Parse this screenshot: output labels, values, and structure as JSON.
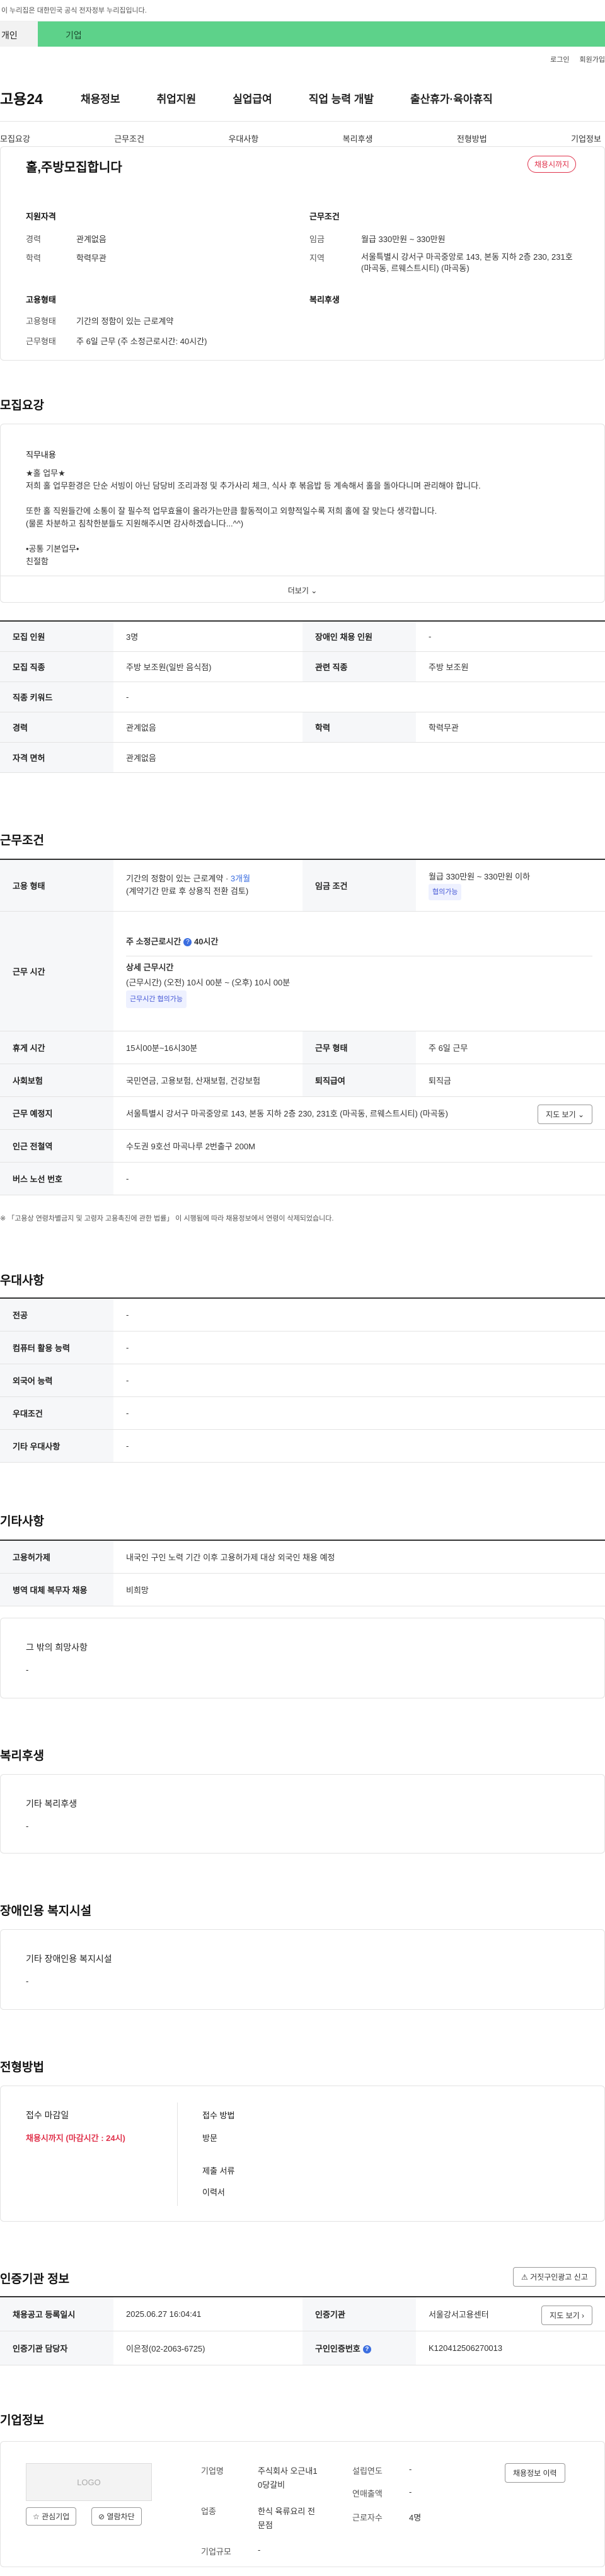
{
  "gov_banner": {
    "text": "이 누리집은 대한민국 공식 전자정부 누리집입니다."
  },
  "top_tabs": {
    "personal": "개인",
    "company": "기업"
  },
  "util": {
    "login": "로그인",
    "join": "회원가입"
  },
  "header": {
    "logo": "고용24",
    "nav": [
      "채용정보",
      "취업지원",
      "실업급여",
      "직업 능력 개발",
      "출산휴가·육아휴직"
    ]
  },
  "anchors": [
    "모집요강",
    "근무조건",
    "우대사항",
    "복리후생",
    "전형방법",
    "기업정보"
  ],
  "summary": {
    "title": "홀,주방모집합니다",
    "status": "채용시까지",
    "qual_h": "지원자격",
    "career_l": "경력",
    "career_v": "관계없음",
    "edu_l": "학력",
    "edu_v": "학력무관",
    "cond_h": "근무조건",
    "wage_l": "임금",
    "wage_v": "월급 330만원 ~ 330만원",
    "area_l": "지역",
    "area_v": "서울특별시 강서구 마곡중앙로 143, 본동 지하 2층 230, 231호 (마곡동, 르웨스트시티) (마곡동)",
    "form_h": "고용형태",
    "emp_l": "고용형태",
    "emp_v": "기간의 정함이 있는 근로계약",
    "work_l": "근무형태",
    "work_v": "주 6일 근무 (주 소정근로시간: 40시간)",
    "welfare_h": "복리후생"
  },
  "recruit": {
    "heading": "모집요강",
    "desc_title": "직무내용",
    "desc_lines": [
      "★홀 업무★",
      "저희 홀 업무환경은 단순 서빙이 아닌 담당비 조리과정 및 추가사리 체크, 식사 후 볶음밥 등 계속해서 홀을 돌아다니며 관리해야 합니다.",
      "",
      "또한 홀 직원들간에 소통이 잘 필수적 업무효율이 올라가는만큼 활동적이고 외향적일수록 저희 홀에 잘 맞는다 생각합니다.",
      "(물론 차분하고 침착한분들도 지원해주시면 감사하겠습니다...^^)",
      "",
      "•공통 기본업무•",
      "친절함"
    ],
    "more": "더보기",
    "rows": [
      [
        "모집 인원",
        "3명",
        "장애인 채용 인원",
        "-"
      ],
      [
        "모집 직종",
        "주방 보조원(일반 음식점)",
        "관련 직종",
        "주방 보조원"
      ],
      [
        "직종 키워드",
        "-"
      ],
      [
        "경력",
        "관계없음",
        "학력",
        "학력무관"
      ],
      [
        "자격 면허",
        "관계없음"
      ]
    ]
  },
  "work": {
    "heading": "근무조건",
    "emp_l": "고용 형태",
    "emp_v1": "기간의 정함이 있는 근로계약 · ",
    "emp_v1b": "3개월",
    "emp_v2": "(계약기간 만료 후 상용직 전환 검토)",
    "wage_l": "임금 조건",
    "wage_v": "월급 330만원 ~ 330만원 이하",
    "wage_pill": "협의가능",
    "time_l": "근무 시간",
    "time_h": "주 소정근로시간",
    "time_h2": "40시간",
    "time_sub": "상세 근무시간",
    "time_v": "(근무시간) (오전) 10시 00분 ~ (오후) 10시 00분",
    "time_pill": "근무시간 협의가능",
    "break_l": "휴게 시간",
    "break_v": "15시00분~16시30분",
    "form_l": "근무 형태",
    "form_v": "주 6일 근무",
    "ins_l": "사회보험",
    "ins_v": "국민연금, 고용보험, 산재보험, 건강보험",
    "ret_l": "퇴직급여",
    "ret_v": "퇴직금",
    "place_l": "근무 예정지",
    "place_v": "서울특별시 강서구 마곡중앙로 143, 본동 지하 2층 230, 231호 (마곡동, 르웨스트시티) (마곡동)",
    "map": "지도 보기",
    "sub_l": "인근 전철역",
    "sub_v": "수도권 9호선 마곡나루 2번출구 200M",
    "bus_l": "버스 노선 번호",
    "bus_v": "-",
    "note": "※ 「고용상 연령차별금지 및 고령자 고용촉진에 관한 법률」 이 시행됨에 따라 채용정보에서 연령이 삭제되었습니다."
  },
  "pref": {
    "heading": "우대사항",
    "rows": [
      [
        "전공",
        "-"
      ],
      [
        "컴퓨터 활용 능력",
        "-"
      ],
      [
        "외국어 능력",
        "-"
      ],
      [
        "우대조건",
        "-"
      ],
      [
        "기타 우대사항",
        "-"
      ]
    ]
  },
  "etc": {
    "heading": "기타사항",
    "rows": [
      [
        "고용허가제",
        "내국인 구인 노력 기간 이후 고용허가제 대상 외국인 채용 예정"
      ],
      [
        "병역 대체 복무자 채용",
        "비희망"
      ]
    ],
    "other_t": "그 밖의 희망사항",
    "other_v": "-"
  },
  "welfare": {
    "heading": "복리후생",
    "t": "기타 복리후생",
    "v": "-"
  },
  "disabled": {
    "heading": "장애인용 복지시설",
    "t": "기타 장애인용 복지시설",
    "v": "-"
  },
  "process": {
    "heading": "전형방법",
    "dead_t": "접수 마감일",
    "dead_v": "채용시까지 (마감시간 : 24시)",
    "method_t": "접수 방법",
    "method_v": "방문",
    "docs_t": "제출 서류",
    "docs_v": "이력서"
  },
  "cert": {
    "heading": "인증기관 정보",
    "report": "거짓구인광고 신고",
    "reg_l": "채용공고 등록일시",
    "reg_v": "2025.06.27 16:04:41",
    "agency_l": "인증기관",
    "agency_v": "서울강서고용센터",
    "map": "지도 보기",
    "mgr_l": "인증기관 담당자",
    "mgr_v": "이은정(02-2063-6725)",
    "num_l": "구인인증번호",
    "num_v": "K120412506270013"
  },
  "company": {
    "heading": "기업정보",
    "logo": "LOGO",
    "fav": "관심기업",
    "block": "열람차단",
    "name_l": "기업명",
    "name_v": "주식회사 오근내1",
    "name_v2": "0당갈비",
    "ind_l": "업종",
    "ind_v": "한식 육류요리 전",
    "ind_v2": "문점",
    "size_l": "기업규모",
    "size_v": "-",
    "est_l": "설립연도",
    "est_v": "-",
    "sales_l": "연매출액",
    "sales_v": "-",
    "emp_l": "근로자수",
    "emp_v": "4명",
    "history": "채용정보 이력"
  }
}
